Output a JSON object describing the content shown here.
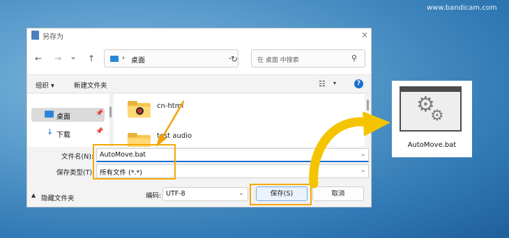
{
  "watermark": "www.bandicam.com",
  "dialog": {
    "title": "另存为",
    "close_icon": "×",
    "nav": {
      "back_icon": "←",
      "forward_icon": "→",
      "dropdown_icon": "⌄",
      "up_icon": "↑",
      "path_separator": "›",
      "path": "桌面",
      "path_chevron": "⌄",
      "refresh_icon": "↻",
      "search_placeholder": "在 桌面 中搜索",
      "search_icon": "⚲"
    },
    "toolbar": {
      "organize": "组织 ▾",
      "new_folder": "新建文件夹",
      "view_icon": "☷",
      "view_caret": "▾",
      "help_icon": "?"
    },
    "sidebar": {
      "items": [
        {
          "label": "桌面",
          "pin": "📌"
        },
        {
          "label": "下载",
          "pin": "📌"
        }
      ],
      "download_icon": "↓"
    },
    "files": [
      {
        "name": "cn-html"
      },
      {
        "name": "test audio"
      }
    ],
    "form": {
      "filename_label": "文件名(N):",
      "filename_value": "AutoMove.bat",
      "filetype_label": "保存类型(T):",
      "filetype_value": "所有文件  (*.*)",
      "chevron": "⌄"
    },
    "footer": {
      "hide_caret": "▲",
      "hide_folders": "隐藏文件夹",
      "encoding_label": "编码:",
      "encoding_value": "UTF-8",
      "save": "保存(S)",
      "cancel": "取消"
    }
  },
  "result_file": {
    "label": "AutoMove.bat",
    "icon": "batch-file-gears-icon"
  },
  "colors": {
    "highlight": "#f7a800",
    "arrow": "#f5c400",
    "accent": "#1a6fd0"
  }
}
